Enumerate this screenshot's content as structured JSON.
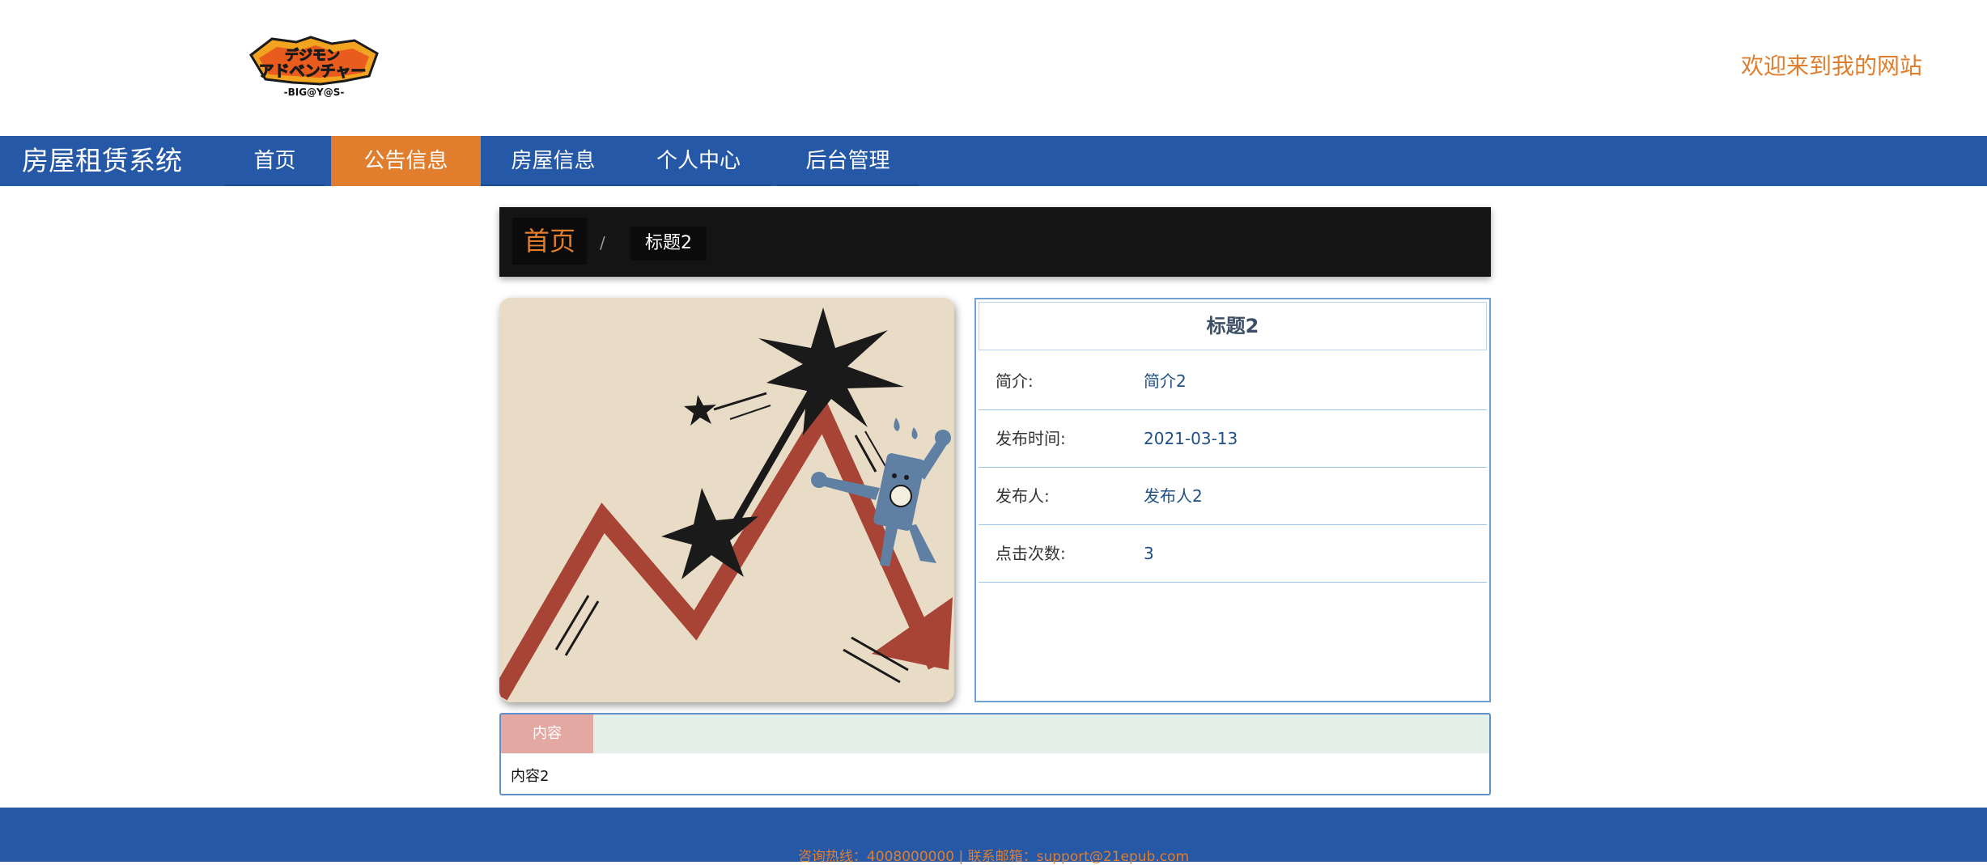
{
  "header": {
    "logo_text_top": "デジモン",
    "logo_text_main": "アドベンチャー",
    "logo_text_sub": "-BIG@Y@S-",
    "welcome": "欢迎来到我的网站"
  },
  "nav": {
    "brand": "房屋租赁系统",
    "items": [
      {
        "label": "首页",
        "active": false
      },
      {
        "label": "公告信息",
        "active": true
      },
      {
        "label": "房屋信息",
        "active": false
      },
      {
        "label": "个人中心",
        "active": false
      },
      {
        "label": "后台管理",
        "active": false
      }
    ]
  },
  "breadcrumb": {
    "home": "首页",
    "separator": "/",
    "current": "标题2"
  },
  "detail": {
    "title": "标题2",
    "rows": [
      {
        "label": "简介:",
        "value": "简介2"
      },
      {
        "label": "发布时间:",
        "value": "2021-03-13"
      },
      {
        "label": "发布人:",
        "value": "发布人2"
      },
      {
        "label": "点击次数:",
        "value": "3"
      }
    ]
  },
  "content": {
    "tab": "内容",
    "body": "内容2"
  },
  "footer": {
    "text": "咨询热线：4008000000 | 联系邮箱：support@21epub.com"
  },
  "colors": {
    "primary": "#2558a6",
    "accent": "#e07e2e",
    "crumb_bg": "#141414",
    "picture_bg": "#e8dcc6",
    "arrow_red": "#a84436",
    "content_tab": "#e4a8a2"
  },
  "icons": {
    "logo": "digimon-adventure-logo",
    "picture": "crashing-chart-illustration"
  }
}
